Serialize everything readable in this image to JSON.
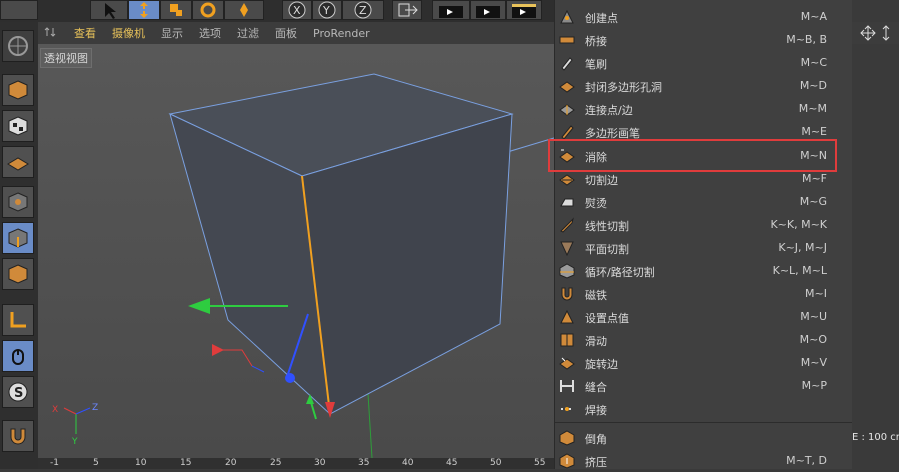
{
  "view_menu": {
    "items": [
      "查看",
      "摄像机",
      "显示",
      "选项",
      "过滤",
      "面板",
      "ProRender"
    ]
  },
  "viewport": {
    "label": "透视视图"
  },
  "ruler": {
    "ticks": [
      "-1",
      "5",
      "10",
      "15",
      "20",
      "25",
      "30",
      "35",
      "40",
      "45",
      "50",
      "55"
    ]
  },
  "axis": {
    "x": "X",
    "y": "Y",
    "z": "Z"
  },
  "menu": {
    "items": [
      {
        "label": "创建点",
        "shortcut": "M~A"
      },
      {
        "label": "桥接",
        "shortcut": "M~B, B"
      },
      {
        "label": "笔刷",
        "shortcut": "M~C"
      },
      {
        "label": "封闭多边形孔洞",
        "shortcut": "M~D"
      },
      {
        "label": "连接点/边",
        "shortcut": "M~M"
      },
      {
        "label": "多边形画笔",
        "shortcut": "M~E"
      },
      {
        "label": "消除",
        "shortcut": "M~N"
      },
      {
        "label": "切割边",
        "shortcut": "M~F"
      },
      {
        "label": "熨烫",
        "shortcut": "M~G"
      },
      {
        "label": "线性切割",
        "shortcut": "K~K, M~K"
      },
      {
        "label": "平面切割",
        "shortcut": "K~J, M~J"
      },
      {
        "label": "循环/路径切割",
        "shortcut": "K~L, M~L"
      },
      {
        "label": "磁铁",
        "shortcut": "M~I"
      },
      {
        "label": "设置点值",
        "shortcut": "M~U"
      },
      {
        "label": "滑动",
        "shortcut": "M~O"
      },
      {
        "label": "旋转边",
        "shortcut": "M~V"
      },
      {
        "label": "缝合",
        "shortcut": "M~P"
      },
      {
        "label": "焊接",
        "shortcut": ""
      },
      {
        "label": "倒角",
        "shortcut": ""
      },
      {
        "label": "挤压",
        "shortcut": "M~T, D"
      }
    ]
  },
  "right_panel": {
    "status": "E : 100 cn"
  },
  "colors": {
    "highlight_border": "#e03c3c",
    "edge_selected": "#f0a020",
    "accent_yellow": "#e8c25a"
  }
}
